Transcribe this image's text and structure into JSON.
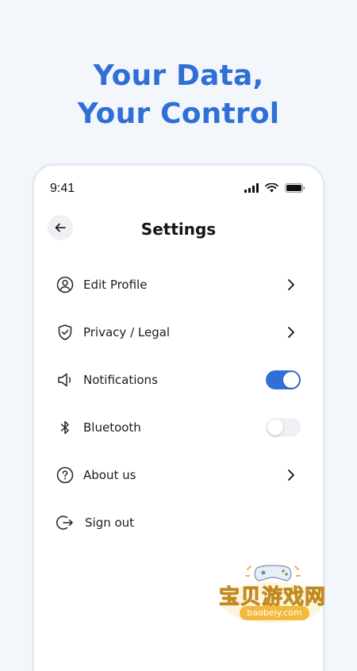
{
  "headline": {
    "line1": "Your Data,",
    "line2": "Your Control"
  },
  "status_bar": {
    "time": "9:41",
    "icons": [
      "signal-icon",
      "wifi-icon",
      "battery-icon"
    ]
  },
  "header": {
    "title": "Settings",
    "back_icon": "arrow-left-icon"
  },
  "menu": {
    "items": [
      {
        "label": "Edit Profile",
        "icon": "user-circle-icon",
        "trailing": "chevron"
      },
      {
        "label": "Privacy / Legal",
        "icon": "shield-check-icon",
        "trailing": "chevron"
      },
      {
        "label": "Notifications",
        "icon": "speaker-icon",
        "trailing": "toggle",
        "toggle_on": true
      },
      {
        "label": "Bluetooth",
        "icon": "bluetooth-icon",
        "trailing": "toggle",
        "toggle_on": false
      },
      {
        "label": "About us",
        "icon": "question-circle-icon",
        "trailing": "chevron"
      },
      {
        "label": "Sign out",
        "icon": "sign-out-icon",
        "trailing": "none"
      }
    ]
  },
  "watermark": {
    "text": "宝贝游戏网",
    "url": "baobeiy.com"
  },
  "colors": {
    "accent": "#2f6fd6",
    "background": "#f3f6fb",
    "toggle_off": "#eef0f3"
  }
}
